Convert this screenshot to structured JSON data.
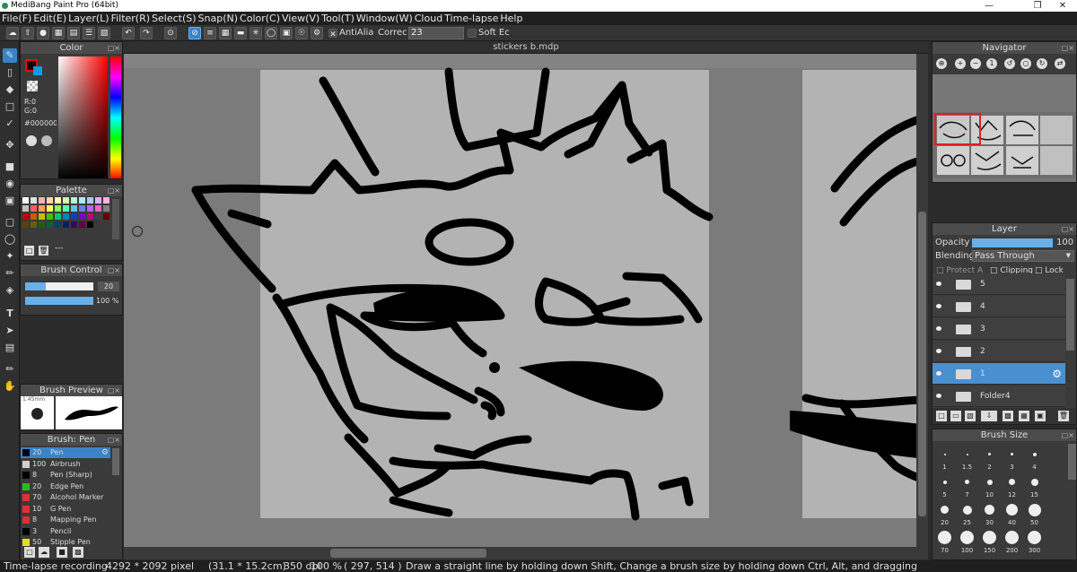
{
  "app": {
    "title": "MediBang Paint Pro (64bit)"
  },
  "menu": [
    "File(F)",
    "Edit(E)",
    "Layer(L)",
    "Filter(R)",
    "Select(S)",
    "Snap(N)",
    "Color(C)",
    "View(V)",
    "Tool(T)",
    "Window(W)",
    "Cloud",
    "Time-lapse",
    "Help"
  ],
  "toolbar": {
    "antialias": "AntiAlia",
    "correction": "Correc",
    "correction_value": "23",
    "soft_edge": "Soft Ec"
  },
  "document": {
    "tab": "stickers b.mdp"
  },
  "color": {
    "title": "Color",
    "fg": "#ff0000",
    "bg": "#00a0e0",
    "r": "R:0",
    "g": "G:0",
    "hex": "#000000"
  },
  "palette": {
    "title": "Palette",
    "colors": [
      "#ffffff",
      "#e0e0e0",
      "#ffb0b0",
      "#ffd8b0",
      "#ffffb0",
      "#d0ffb0",
      "#b0ffd8",
      "#b0e8ff",
      "#b0c8ff",
      "#e0b0ff",
      "#ffb0e8",
      "#c0c0c0",
      "#ff6060",
      "#ffa050",
      "#ffff60",
      "#80ff60",
      "#60ffb0",
      "#60c0ff",
      "#6080ff",
      "#c060ff",
      "#ff60c0",
      "#808080",
      "#c00000",
      "#c06000",
      "#c0c000",
      "#40c000",
      "#00c080",
      "#0080c0",
      "#0040c0",
      "#8000c0",
      "#c00080",
      "#404040",
      "#600000",
      "#604000",
      "#606000",
      "#206000",
      "#006040",
      "#004060",
      "#002060",
      "#400060",
      "#600040",
      "#000000"
    ]
  },
  "brush_control": {
    "title": "Brush Control",
    "size": "20",
    "opacity": "100 %",
    "size_fraction": 0.3,
    "opacity_fraction": 1.0
  },
  "brush_preview": {
    "title": "Brush Preview",
    "size": "1.45mm"
  },
  "brushes": {
    "title": "Brush: Pen",
    "items": [
      {
        "size": "20",
        "name": "Pen",
        "color": "#000000",
        "selected": true
      },
      {
        "size": "100",
        "name": "Airbrush",
        "color": "#d0d0d0"
      },
      {
        "size": "8",
        "name": "Pen (Sharp)",
        "color": "#000000"
      },
      {
        "size": "20",
        "name": "Edge Pen",
        "color": "#20c020"
      },
      {
        "size": "70",
        "name": "Alcohol Marker",
        "color": "#e03030"
      },
      {
        "size": "10",
        "name": "G Pen",
        "color": "#e03030"
      },
      {
        "size": "8",
        "name": "Mapping Pen",
        "color": "#e03030"
      },
      {
        "size": "3",
        "name": "Pencil",
        "color": "#000000"
      },
      {
        "size": "50",
        "name": "Stipple Pen",
        "color": "#e0e020"
      }
    ]
  },
  "navigator": {
    "title": "Navigator"
  },
  "layer": {
    "title": "Layer",
    "opacity_label": "Opacity",
    "opacity_value": "100",
    "opacity_fraction": 1.0,
    "blending_label": "Blending",
    "blending_value": "Pass Through",
    "protect": "Protect A",
    "clipping": "Clipping",
    "lock": "Lock",
    "items": [
      {
        "name": "5"
      },
      {
        "name": "4"
      },
      {
        "name": "3"
      },
      {
        "name": "2"
      },
      {
        "name": "1",
        "selected": true
      },
      {
        "name": "Folder4"
      }
    ]
  },
  "brush_size": {
    "title": "Brush Size",
    "sizes": [
      "1",
      "1.5",
      "2",
      "3",
      "4",
      "5",
      "7",
      "10",
      "12",
      "15",
      "20",
      "25",
      "30",
      "40",
      "50",
      "70",
      "100",
      "150",
      "200",
      "300"
    ]
  },
  "status": {
    "recording": "Time-lapse recording",
    "pixels": "4292 * 2092 pixel",
    "cm": "(31.1 * 15.2cm)",
    "dpi": "350 dpi",
    "zoom": "100 %",
    "coords": "( 297, 514 )",
    "hint": "Draw a straight line by holding down Shift, Change a brush size by holding down Ctrl, Alt, and dragging"
  }
}
